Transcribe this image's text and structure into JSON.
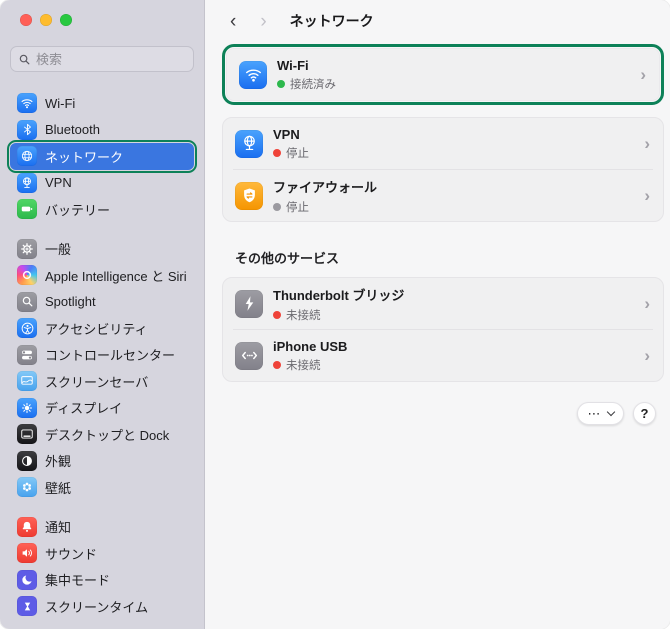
{
  "window": {
    "traffic_lights": {
      "close": "#ff5f57",
      "minimize": "#febc2e",
      "maximize": "#28c840"
    }
  },
  "sidebar": {
    "search": {
      "placeholder": "検索"
    },
    "groups": [
      {
        "items": [
          {
            "label": "Wi-Fi",
            "icon": "wifi-icon"
          },
          {
            "label": "Bluetooth",
            "icon": "bluetooth-icon"
          },
          {
            "label": "ネットワーク",
            "icon": "globe-icon",
            "selected": true,
            "annotated": true
          },
          {
            "label": "VPN",
            "icon": "vpn-globe-icon"
          },
          {
            "label": "バッテリー",
            "icon": "battery-icon"
          }
        ]
      },
      {
        "items": [
          {
            "label": "一般",
            "icon": "gear-icon"
          },
          {
            "label": "Apple Intelligence と Siri",
            "icon": "siri-icon"
          },
          {
            "label": "Spotlight",
            "icon": "magnifier-icon"
          },
          {
            "label": "アクセシビリティ",
            "icon": "accessibility-icon"
          },
          {
            "label": "コントロールセンター",
            "icon": "toggles-icon"
          },
          {
            "label": "スクリーンセーバ",
            "icon": "screensaver-icon"
          },
          {
            "label": "ディスプレイ",
            "icon": "sun-display-icon"
          },
          {
            "label": "デスクトップと Dock",
            "icon": "desktop-dock-icon"
          },
          {
            "label": "外観",
            "icon": "appearance-icon"
          },
          {
            "label": "壁紙",
            "icon": "wallpaper-flower-icon"
          }
        ]
      },
      {
        "items": [
          {
            "label": "通知",
            "icon": "bell-icon"
          },
          {
            "label": "サウンド",
            "icon": "speaker-icon"
          },
          {
            "label": "集中モード",
            "icon": "moon-icon"
          },
          {
            "label": "スクリーンタイム",
            "icon": "hourglass-icon"
          }
        ]
      }
    ]
  },
  "header": {
    "back_glyph": "‹",
    "forward_glyph": "›",
    "title": "ネットワーク"
  },
  "content": {
    "wifi_card": {
      "title": "Wi-Fi",
      "status": "接続済み"
    },
    "vpn_row": {
      "title": "VPN",
      "status": "停止"
    },
    "firewall_row": {
      "title": "ファイアウォール",
      "status": "停止"
    },
    "section_title": "その他のサービス",
    "thunderbolt_row": {
      "title": "Thunderbolt ブリッジ",
      "status": "未接続"
    },
    "iphone_row": {
      "title": "iPhone USB",
      "status": "未接続"
    },
    "footer": {
      "more_glyph": "⋯",
      "help_label": "?"
    }
  },
  "colors": {
    "annotation_green": "#0d8158",
    "selection_blue": "#3a76e0",
    "status_connected_green": "#2db84d",
    "status_stopped_red": "#ef4339",
    "status_stopped_gray": "#9b9aa0",
    "status_disconnected_red": "#ef4339",
    "sidebar_bg": "#d6d5de",
    "main_bg": "#f6f6f7",
    "card_bg": "#f0f0f1"
  }
}
